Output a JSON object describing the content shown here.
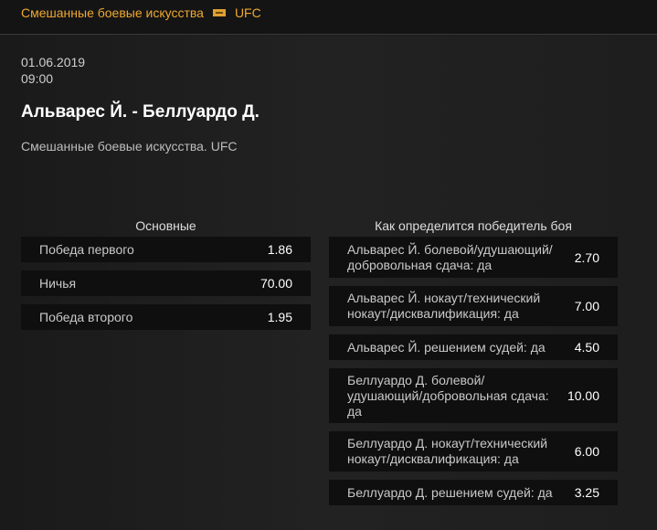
{
  "breadcrumb": {
    "sport": "Смешанные боевые искусства",
    "league": "UFC"
  },
  "event": {
    "date": "01.06.2019",
    "time": "09:00",
    "title": "Альварес Й. - Беллуардо Д.",
    "subtitle": "Смешанные боевые искусства. UFC"
  },
  "markets": [
    {
      "title": "Основные",
      "rows": [
        {
          "label": "Победа первого",
          "odds": "1.86"
        },
        {
          "label": "Ничья",
          "odds": "70.00"
        },
        {
          "label": "Победа второго",
          "odds": "1.95"
        }
      ]
    },
    {
      "title": "Как определится победитель боя",
      "rows": [
        {
          "label": "Альварес Й. болевой/удушающий/\nдобровольная сдача: да",
          "odds": "2.70"
        },
        {
          "label": "Альварес Й. нокаут/технический\nнокаут/дисквалификация: да",
          "odds": "7.00"
        },
        {
          "label": "Альварес Й. решением судей: да",
          "odds": "4.50"
        },
        {
          "label": "Беллуардо Д. болевой/\nудушающий/добровольная сдача:\nда",
          "odds": "10.00"
        },
        {
          "label": "Беллуардо Д. нокаут/технический\nнокаут/дисквалификация: да",
          "odds": "6.00"
        },
        {
          "label": "Беллуардо Д. решением судей: да",
          "odds": "3.25"
        }
      ]
    }
  ],
  "icons": {
    "flag": "mma-flag-icon"
  },
  "colors": {
    "accent": "#f0a830",
    "background": "#1c1c1c",
    "row_bg": "#0f0f0f"
  }
}
